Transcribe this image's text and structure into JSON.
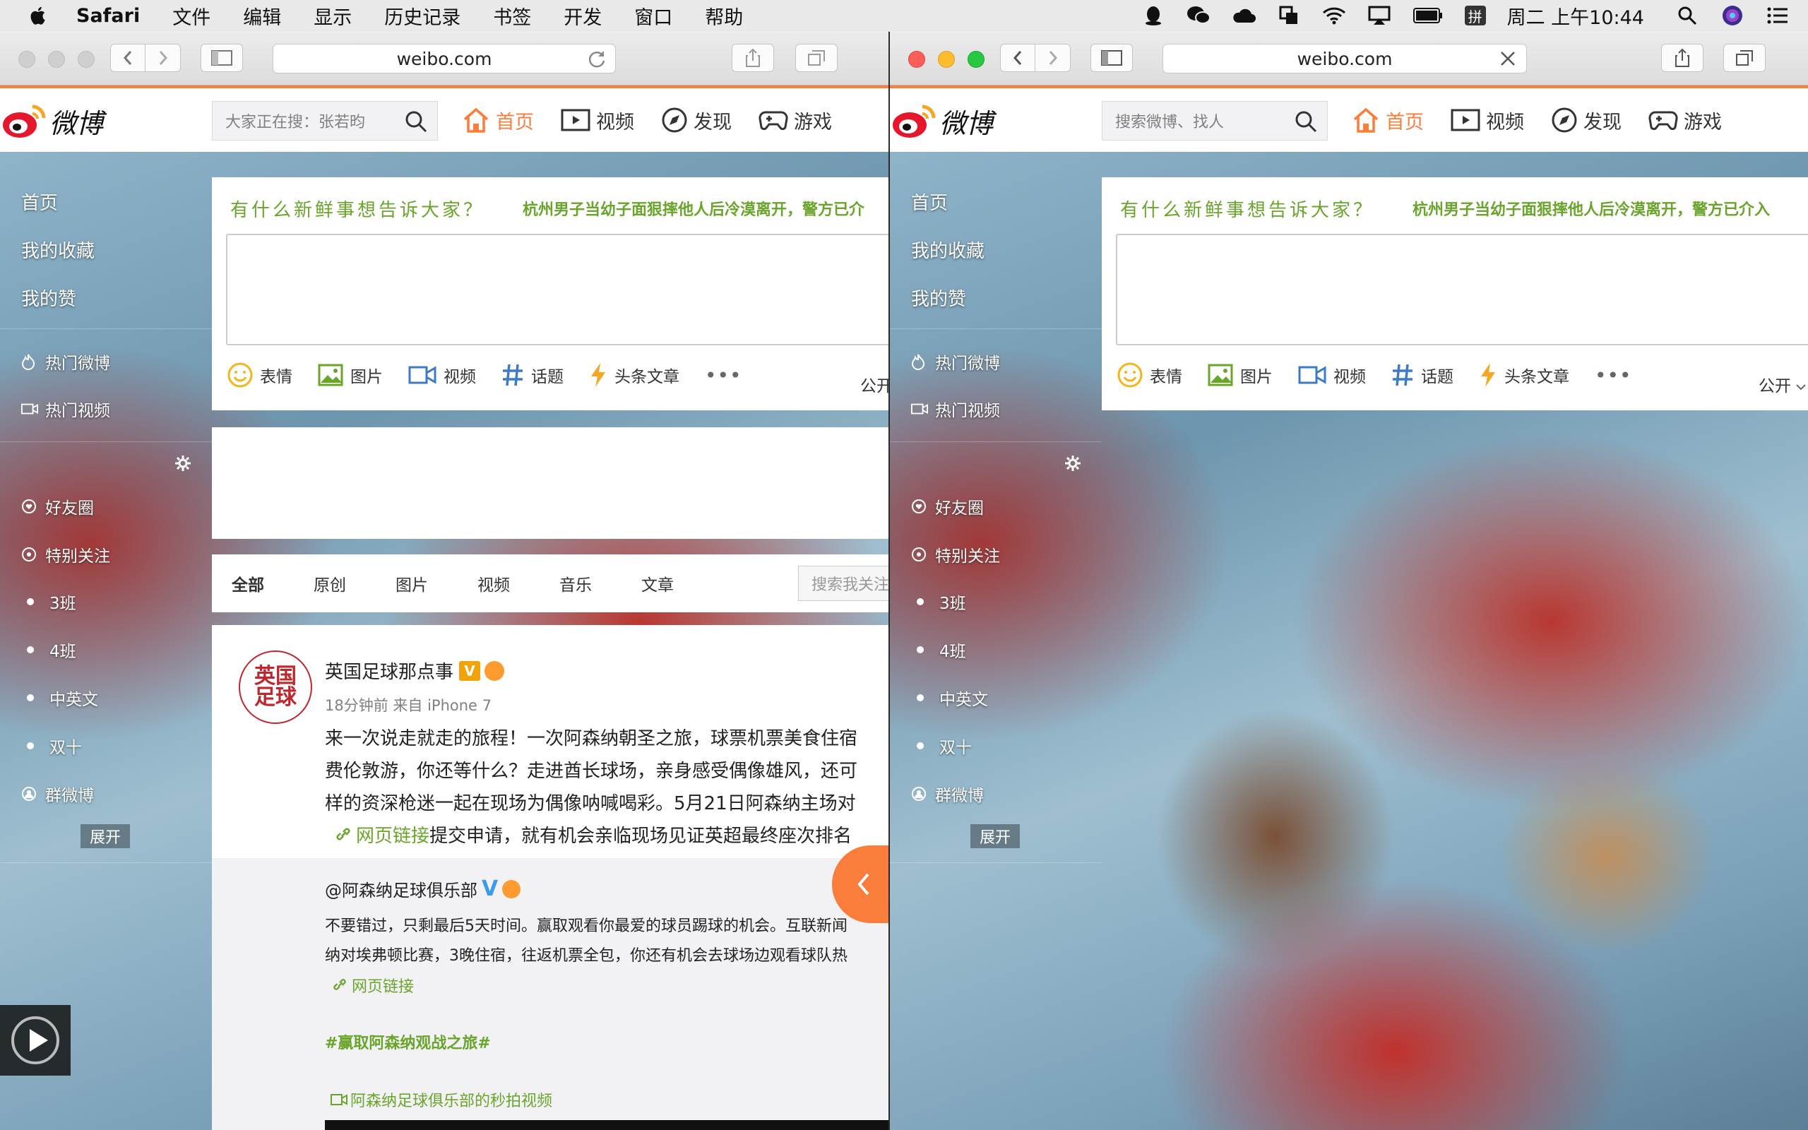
{
  "menubar": {
    "app": "Safari",
    "menus": [
      "文件",
      "编辑",
      "显示",
      "历史记录",
      "书签",
      "开发",
      "窗口",
      "帮助"
    ],
    "status_icons": [
      "qq-icon",
      "wechat-icon",
      "cloud-icon",
      "screen-mirror-icon",
      "wifi-icon",
      "airplay-icon",
      "battery-icon",
      "input-method-icon"
    ],
    "input_method": "拼",
    "clock": "周二 上午10:44"
  },
  "left_window": {
    "url": "weibo.com",
    "search_placeholder": "大家正在搜：张若昀",
    "nav": [
      "首页",
      "视频",
      "发现",
      "游戏"
    ],
    "sidebar": {
      "primary": [
        "首页",
        "我的收藏",
        "我的赞"
      ],
      "hot": [
        "热门微博",
        "热门视频"
      ],
      "groups": [
        "好友圈",
        "特别关注"
      ],
      "lists": [
        "3班",
        "4班",
        "中英文",
        "双十"
      ],
      "group_weibo": "群微博",
      "expand": "展开"
    },
    "composer": {
      "hint": "有什么新鲜事想告诉大家？",
      "news": "杭州男子当幼子面狠摔他人后冷漠离开，警方已介",
      "tools": [
        "表情",
        "图片",
        "视频",
        "话题",
        "头条文章"
      ],
      "more": "•••",
      "visibility": "公开"
    },
    "tabs": [
      "全部",
      "原创",
      "图片",
      "视频",
      "音乐",
      "文章"
    ],
    "tab_search_placeholder": "搜索我关注",
    "post": {
      "avatar_text": "英国足球",
      "author": "英国足球那点事",
      "badge": "V",
      "meta": "18分钟前 来自 iPhone 7",
      "lines": [
        "来一次说走就走的旅程！一次阿森纳朝圣之旅，球票机票美食住宿",
        "费伦敦游，你还等什么？走进酋长球场，亲身感受偶像雄风，还可",
        "样的资深枪迷一起在现场为偶像呐喊喝彩。5月21日阿森纳主场对"
      ],
      "link_text": "网页链接",
      "link_tail": "提交申请，就有机会亲临现场见证英超最终座次排名",
      "repost": {
        "author": "@阿森纳足球俱乐部",
        "lines": [
          "不要错过，只剩最后5天时间。赢取观看你最爱的球员踢球的机会。互联新闻",
          "纳对埃弗顿比赛，3晚住宿，往返机票全包，你还有机会去球场边观看球队热"
        ],
        "link": "网页链接",
        "tag": "#赢取阿森纳观战之旅#",
        "video": "阿森纳足球俱乐部的秒拍视频"
      }
    }
  },
  "right_window": {
    "url": "weibo.com",
    "search_placeholder": "搜索微博、找人",
    "nav": [
      "首页",
      "视频",
      "发现",
      "游戏"
    ],
    "sidebar": {
      "primary": [
        "首页",
        "我的收藏",
        "我的赞"
      ],
      "hot": [
        "热门微博",
        "热门视频"
      ],
      "groups": [
        "好友圈",
        "特别关注"
      ],
      "lists": [
        "3班",
        "4班",
        "中英文",
        "双十"
      ],
      "group_weibo": "群微博",
      "expand": "展开"
    },
    "composer": {
      "hint": "有什么新鲜事想告诉大家？",
      "news": "杭州男子当幼子面狠摔他人后冷漠离开，警方已介入",
      "tools": [
        "表情",
        "图片",
        "视频",
        "话题",
        "头条文章"
      ],
      "more": "•••",
      "visibility": "公开"
    }
  },
  "colors": {
    "accent": "#fa7d3c",
    "green_link": "#6aa52b",
    "menubar_bg": "#e9e9ea"
  }
}
